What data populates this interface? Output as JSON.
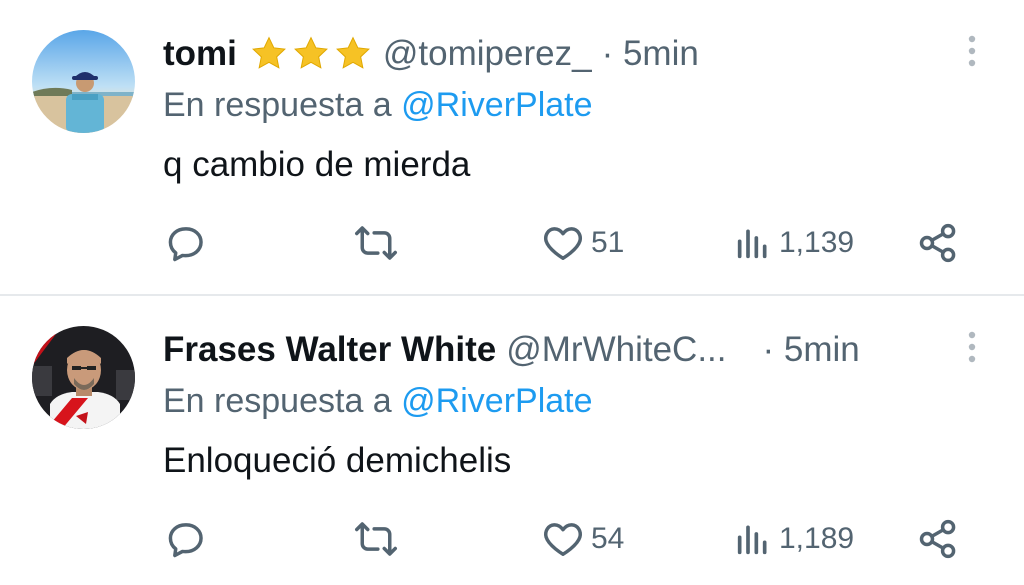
{
  "colors": {
    "text": "#0f1419",
    "secondary": "#536471",
    "link": "#1d9bf0",
    "star": "#f6c225",
    "divider": "#e6e9ec"
  },
  "tweets": [
    {
      "display_name": "tomi",
      "badges": [
        "star-icon",
        "star-icon",
        "star-icon"
      ],
      "handle": "@tomiperez_",
      "time": "· 5min",
      "reply_prefix": "En respuesta a ",
      "reply_to": "@RiverPlate",
      "text": "q cambio de mierda",
      "actions": {
        "reply_icon": "comment-icon",
        "repost_icon": "repost-icon",
        "like_icon": "heart-icon",
        "likes": "51",
        "views_icon": "views-bar-chart-icon",
        "views": "1,139",
        "share_icon": "share-icon"
      }
    },
    {
      "display_name": "Frases Walter White",
      "handle": "@MrWhiteC...",
      "time": "· 5min",
      "reply_prefix": "En respuesta a ",
      "reply_to": "@RiverPlate",
      "text": "Enloqueció demichelis",
      "actions": {
        "reply_icon": "comment-icon",
        "repost_icon": "repost-icon",
        "like_icon": "heart-icon",
        "likes": "54",
        "views_icon": "views-bar-chart-icon",
        "views": "1,189",
        "share_icon": "share-icon"
      }
    }
  ]
}
